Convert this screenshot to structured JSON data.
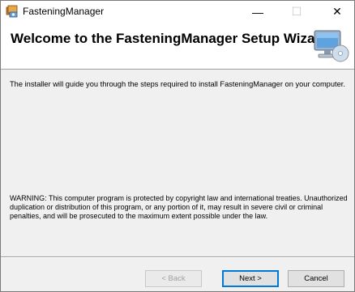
{
  "window": {
    "title": "FasteningManager",
    "minimize_glyph": "—",
    "maximize_glyph": "☐",
    "close_glyph": "✕"
  },
  "banner": {
    "title": "Welcome to the FasteningManager Setup Wizard",
    "icon": "computer-cd-icon"
  },
  "content": {
    "intro": "The installer will guide you through the steps required to install FasteningManager on your computer.",
    "warning": "WARNING: This computer program is protected by copyright law and international treaties. Unauthorized duplication or distribution of this program, or any portion of it, may result in severe civil or criminal penalties, and will be prosecuted to the maximum extent possible under the law."
  },
  "buttons": {
    "back": "< Back",
    "next": "Next >",
    "cancel": "Cancel"
  },
  "colors": {
    "dialog_bg": "#f0f0f0",
    "banner_bg": "#ffffff",
    "focus_border": "#0078d7"
  }
}
